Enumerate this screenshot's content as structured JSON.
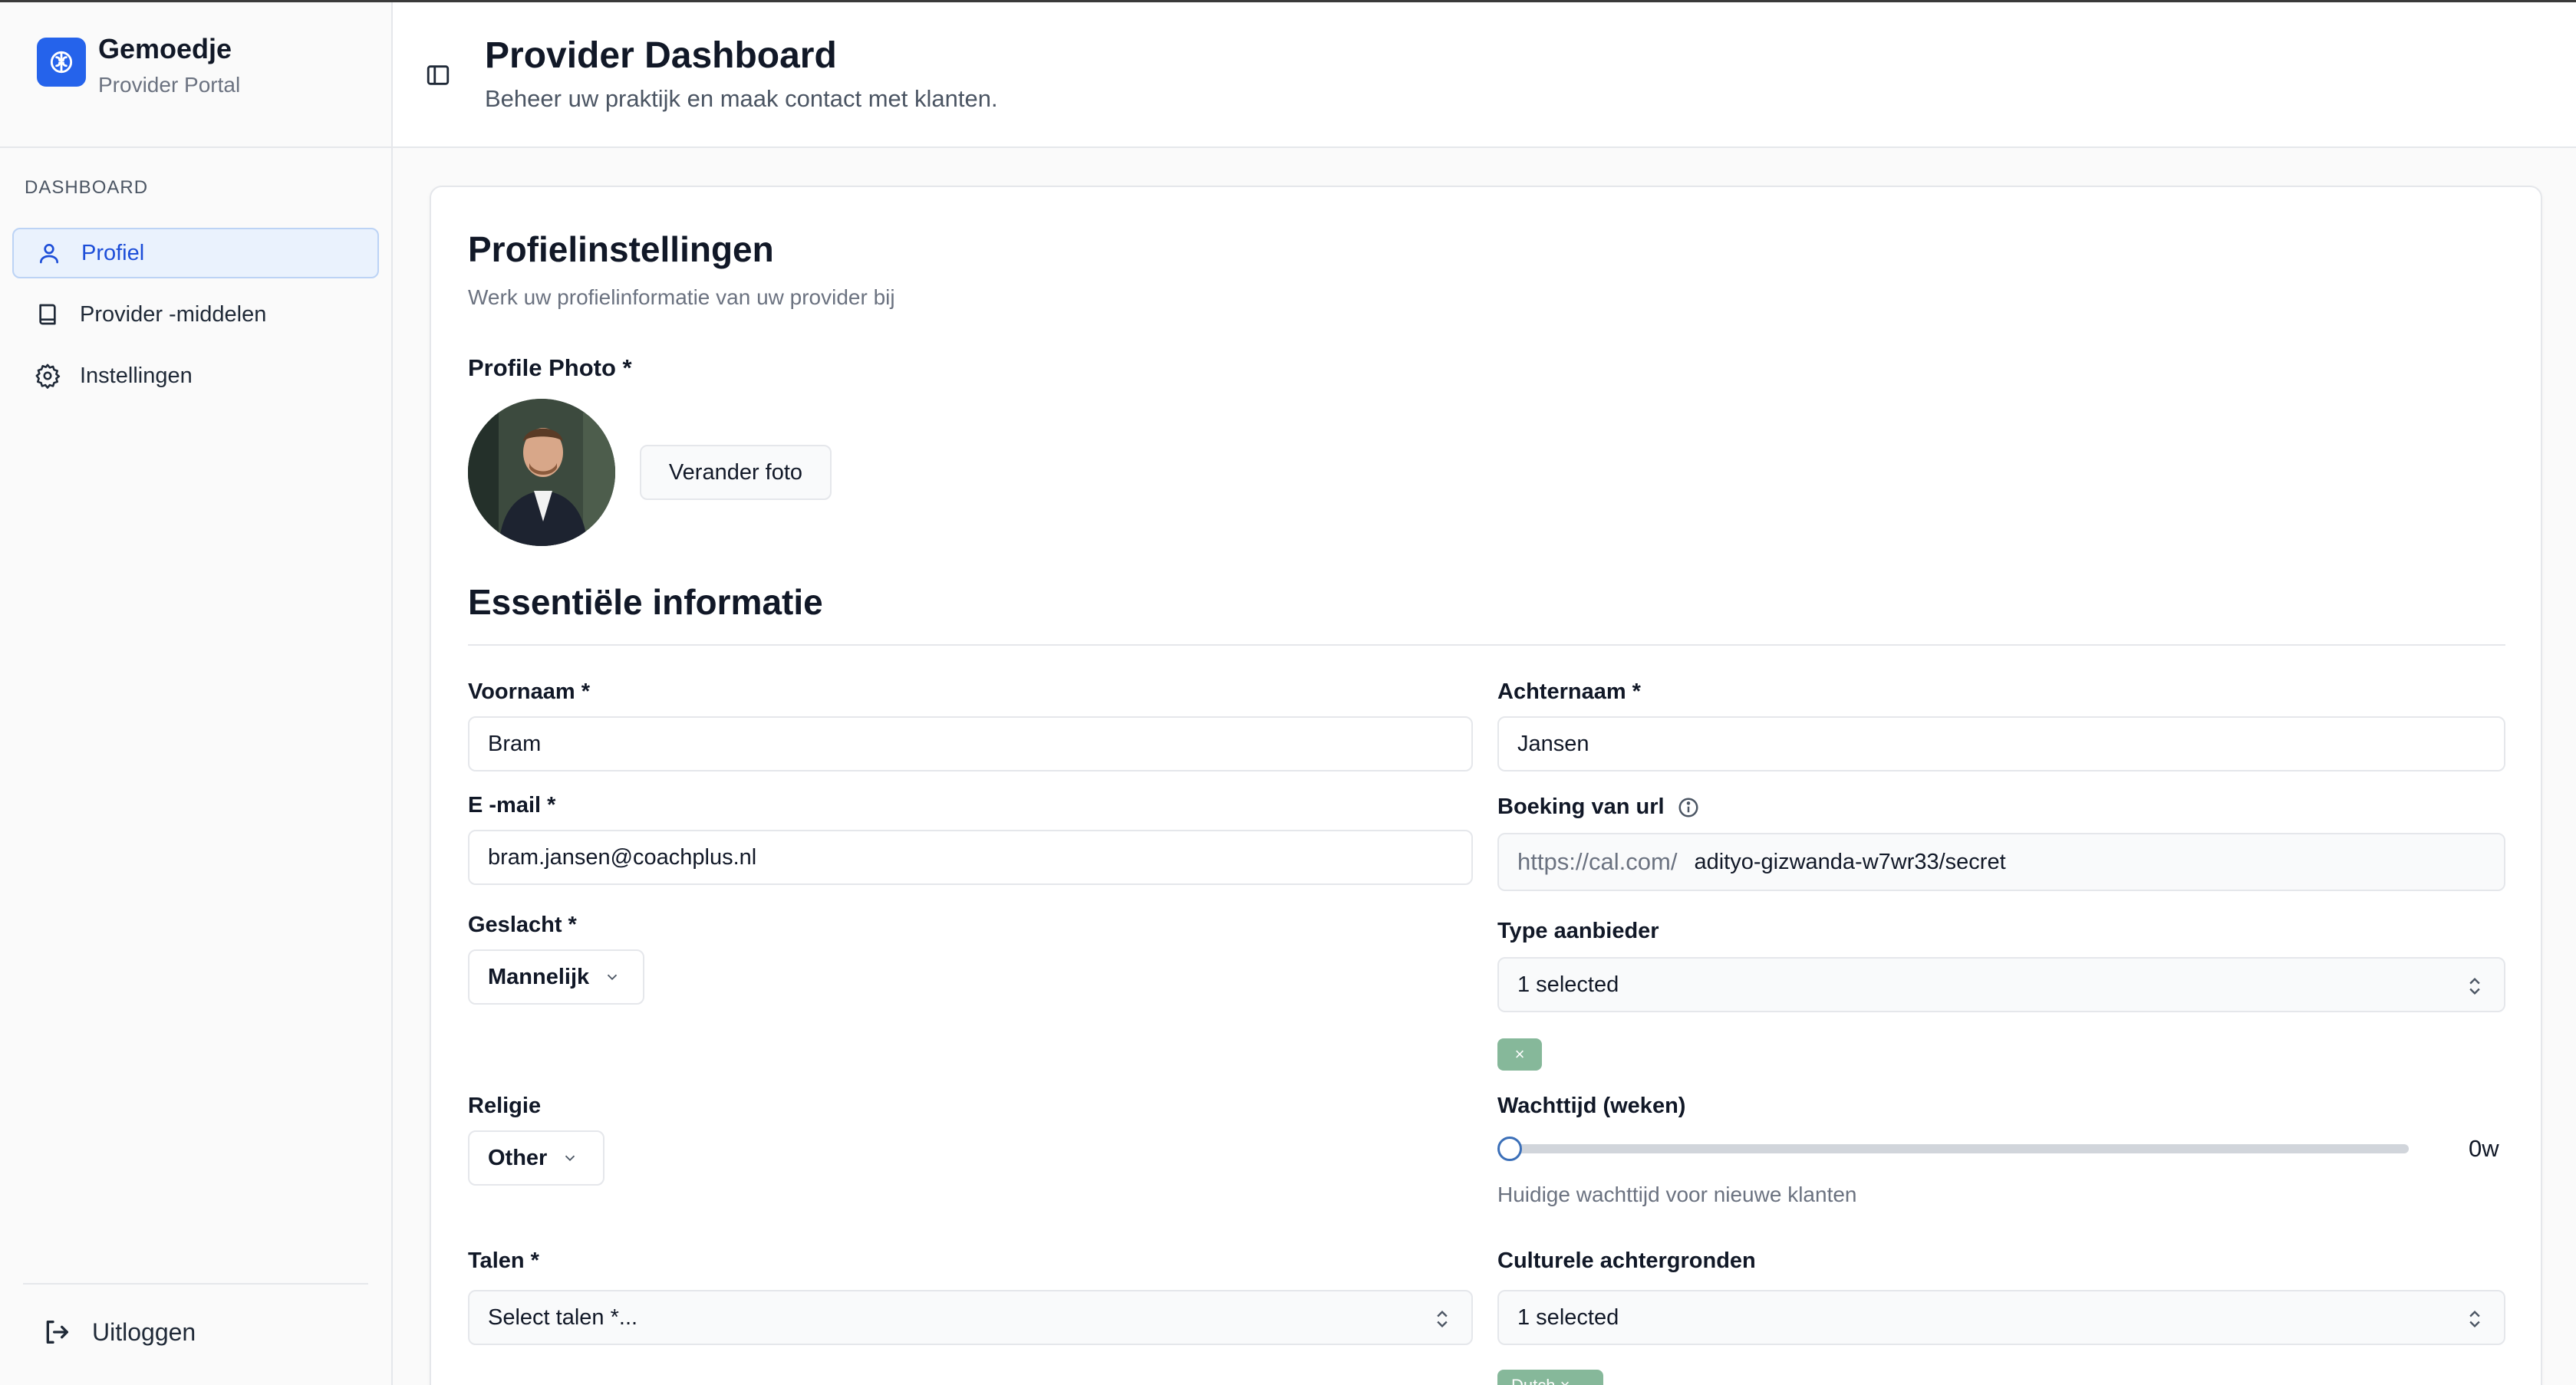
{
  "brand": {
    "name": "Gemoedje",
    "subtitle": "Provider Portal"
  },
  "sidebar": {
    "heading": "DASHBOARD",
    "items": [
      {
        "label": "Profiel",
        "icon": "user-icon",
        "active": true
      },
      {
        "label": "Provider -middelen",
        "icon": "book-icon",
        "active": false
      },
      {
        "label": "Instellingen",
        "icon": "gear-icon",
        "active": false
      }
    ],
    "logout_label": "Uitloggen"
  },
  "header": {
    "title": "Provider Dashboard",
    "subtitle": "Beheer uw praktijk en maak contact met klanten."
  },
  "profile": {
    "title": "Profielinstellingen",
    "subtitle": "Werk uw profielinformatie van uw provider bij",
    "photo_label": "Profile Photo *",
    "change_photo_label": "Verander foto"
  },
  "essential": {
    "title": "Essentiële informatie",
    "first_name": {
      "label": "Voornaam *",
      "value": "Bram"
    },
    "last_name": {
      "label": "Achternaam *",
      "value": "Jansen"
    },
    "email": {
      "label": "E -mail *",
      "value": "bram.jansen@coachplus.nl"
    },
    "booking_url": {
      "label": "Boeking van url",
      "prefix": "https://cal.com/",
      "value": "adityo-gizwanda-w7wr33/secret"
    },
    "gender": {
      "label": "Geslacht *",
      "value": "Mannelijk"
    },
    "provider_type": {
      "label": "Type aanbieder",
      "value": "1 selected",
      "chip": "×"
    },
    "religion": {
      "label": "Religie",
      "value": "Other"
    },
    "waiting_time": {
      "label": "Wachttijd (weken)",
      "value": 0,
      "value_label": "0w",
      "help": "Huidige wachttijd voor nieuwe klanten"
    },
    "languages": {
      "label": "Talen *",
      "placeholder": "Select talen *..."
    },
    "cultural": {
      "label": "Culturele achtergronden",
      "value": "1 selected",
      "chip": "Dutch ×"
    }
  },
  "colors": {
    "accent": "#2563eb",
    "chip": "#86b89a",
    "active_bg": "#eaf2fd"
  }
}
